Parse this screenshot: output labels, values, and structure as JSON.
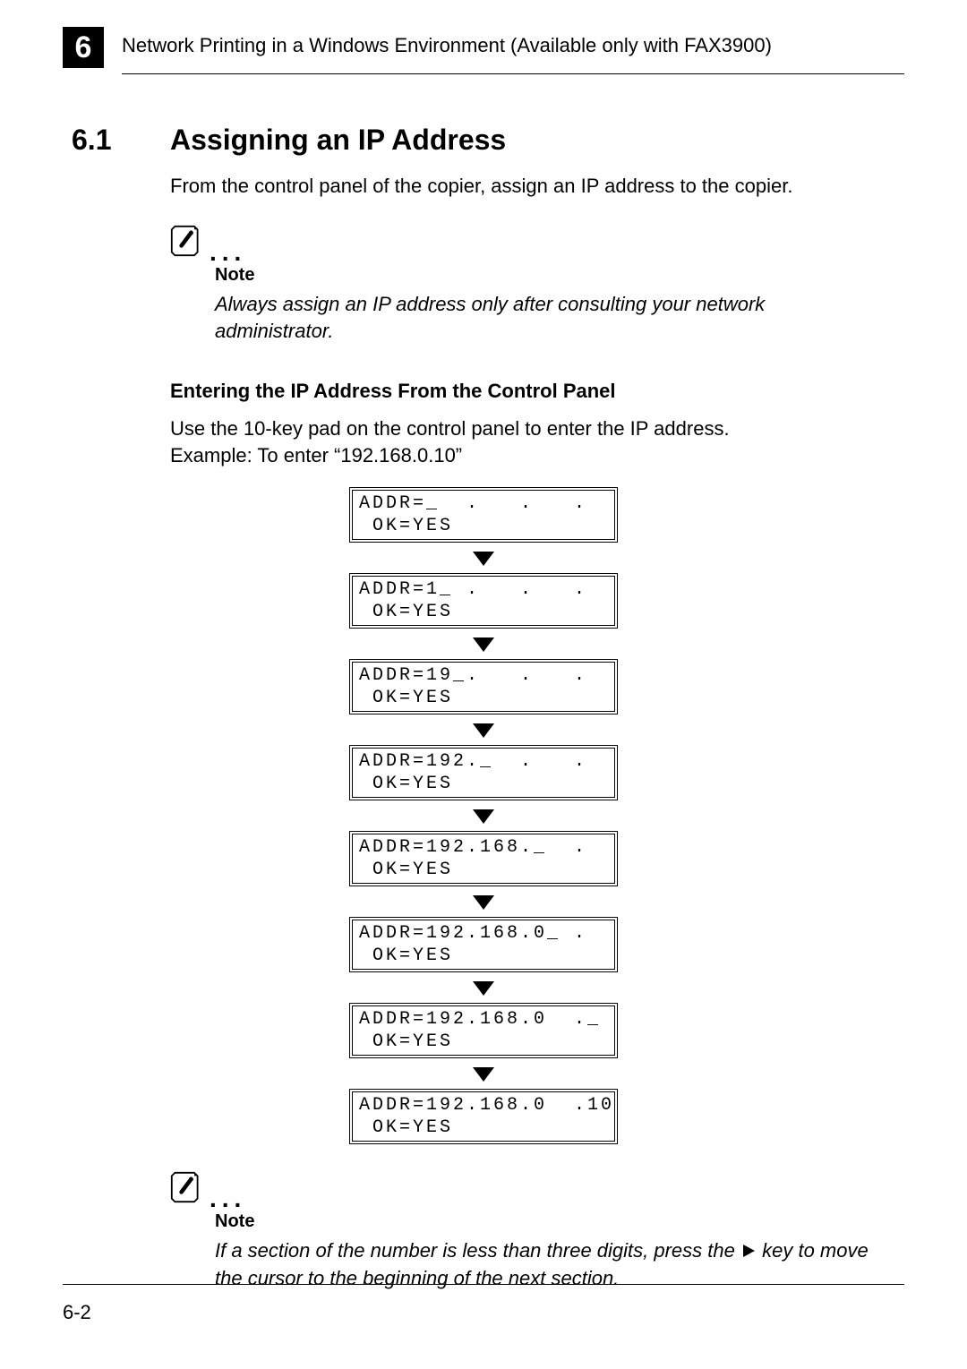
{
  "chapter_number": "6",
  "chapter_title": "Network Printing in a Windows Environment (Available only with FAX3900)",
  "section_number": "6.1",
  "section_title": "Assigning an IP Address",
  "intro_text": "From the control panel of the copier, assign an IP address to the copier.",
  "note1": {
    "label": "Note",
    "body": "Always assign an IP address only after consulting your network administrator."
  },
  "subheading": "Entering the IP Address From the Control Panel",
  "body_line1": "Use the 10-key pad on the control panel to enter the IP address.",
  "body_line2": "Example: To enter “192.168.0.10”",
  "lcd_steps": [
    {
      "line1": "ADDR=_  .   .   .",
      "line2": " OK=YES"
    },
    {
      "line1": "ADDR=1_ .   .   .",
      "line2": " OK=YES"
    },
    {
      "line1": "ADDR=19_.   .   .",
      "line2": " OK=YES"
    },
    {
      "line1": "ADDR=192._  .   .",
      "line2": " OK=YES"
    },
    {
      "line1": "ADDR=192.168._  .",
      "line2": " OK=YES"
    },
    {
      "line1": "ADDR=192.168.0_ .",
      "line2": " OK=YES"
    },
    {
      "line1": "ADDR=192.168.0  ._",
      "line2": " OK=YES"
    },
    {
      "line1": "ADDR=192.168.0  .10",
      "line2": " OK=YES"
    }
  ],
  "note2": {
    "label": "Note",
    "body_before": "If a section of the number is less than three digits, press the ",
    "body_after": " key to move the cursor to the beginning of the next section."
  },
  "page_number": "6-2"
}
